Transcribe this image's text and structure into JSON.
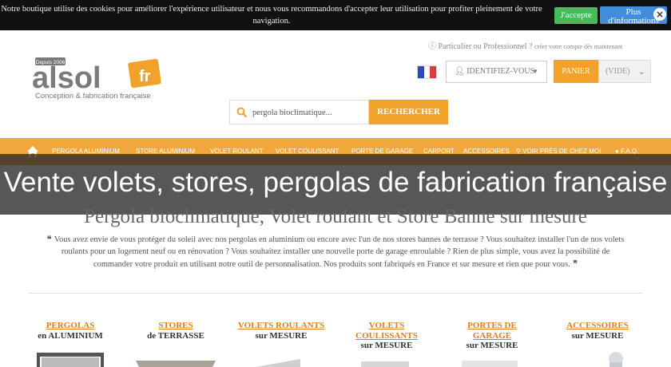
{
  "cookie": {
    "text": "Notre boutique utilise des cookies pour améliorer l'expérience utilisateur et nous vous recommandons d'accepter leur utilisation pour profiter pleinement de votre navigation.",
    "accept_label": "J'accepte",
    "more_label": "Plus d'informations"
  },
  "header": {
    "account_text": "Particulier ou Professionnel ?",
    "account_sub": "créer votre compte dès maintenant",
    "logo_badge": "Depuis 2006",
    "logo_main": "alsol",
    "logo_fr": "fr",
    "logo_tagline": "Conception & fabrication française",
    "identify_label": "IDENTIFIEZ-VOUS",
    "cart_label": "PANIER",
    "cart_status": "(VIDE)"
  },
  "search": {
    "value": "pergola bioclimatique...",
    "button_label": "RECHERCHER"
  },
  "nav": {
    "items": [
      "PERGOLA ALUMINIUM",
      "STORE ALUMINIUM",
      "VOLET ROULANT",
      "VOLET COULISSANT",
      "PORTE DE GARAGE",
      "CARPORT",
      "ACCESSOIRES",
      "VOIR PRÈS DE CHEZ MOI",
      "F.A.Q."
    ]
  },
  "banner": {
    "text": "Vente volets, stores, pergolas de fabrication française"
  },
  "main": {
    "title": "Pergola bioclimatique, Volet roulant et Store Banne sur mesure",
    "intro": "Vous avez envie de vous protéger du soleil avec nos pergolas en aluminium ou encore avec l'un de nos stores bannes de terrasse ? Vous souhaitez installer l'un de nos volets roulants pour un logement neuf ou en rénovation ? Vous souhaitez installer une nouvelle porte de garage enroulable ? Rien de plus simple, vous avez la possibilité de commander votre produit en utilisant notre outil de personnalisation. Nos produits sont fabriqués en France et sur mesure et rien que pour vous."
  },
  "categories": [
    {
      "title": "PERGOLAS",
      "sub": "en ALUMINIUM"
    },
    {
      "title": "STORES",
      "sub": "de TERRASSE"
    },
    {
      "title": "VOLETS ROULANTS",
      "sub": "sur MESURE"
    },
    {
      "title": "VOLETS COULISSANTS",
      "sub": "sur MESURE"
    },
    {
      "title": "PORTES DE GARAGE",
      "sub": "sur MESURE"
    },
    {
      "title": "ACCESSOIRES",
      "sub": "sur MESURE"
    }
  ],
  "colors": {
    "accent": "#f0a22b",
    "nav": "#f2a73c",
    "link": "#e07d17",
    "accept": "#49b95b",
    "more": "#3f8ddb"
  }
}
